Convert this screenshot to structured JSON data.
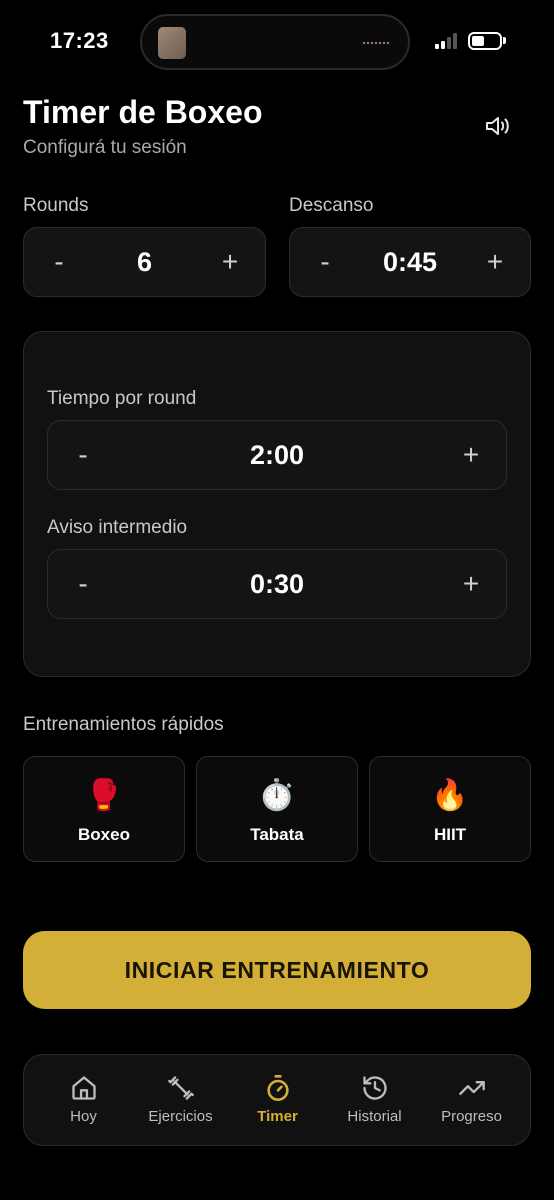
{
  "status_bar": {
    "time": "17:23"
  },
  "header": {
    "title": "Timer de Boxeo",
    "subtitle": "Configurá tu sesión",
    "sound_icon": "speaker-icon"
  },
  "rounds": {
    "label": "Rounds",
    "value": "6",
    "minus": "-",
    "plus": "+"
  },
  "rest": {
    "label": "Descanso",
    "value": "0:45",
    "minus": "-",
    "plus": "+"
  },
  "round_time": {
    "label": "Tiempo por round",
    "value": "2:00",
    "minus": "-",
    "plus": "+"
  },
  "mid_alert": {
    "label": "Aviso intermedio",
    "value": "0:30",
    "minus": "-",
    "plus": "+"
  },
  "quick": {
    "title": "Entrenamientos rápidos",
    "items": [
      {
        "emoji": "🥊",
        "label": "Boxeo",
        "icon": "boxing-glove-icon"
      },
      {
        "emoji": "⏱️",
        "label": "Tabata",
        "icon": "stopwatch-icon"
      },
      {
        "emoji": "🔥",
        "label": "HIIT",
        "icon": "fire-icon"
      }
    ]
  },
  "cta": {
    "label": "INICIAR ENTRENAMIENTO"
  },
  "nav": {
    "items": [
      {
        "label": "Hoy",
        "icon": "home-icon",
        "active": false
      },
      {
        "label": "Ejercicios",
        "icon": "dumbbell-icon",
        "active": false
      },
      {
        "label": "Timer",
        "icon": "timer-icon",
        "active": true
      },
      {
        "label": "Historial",
        "icon": "history-icon",
        "active": false
      },
      {
        "label": "Progreso",
        "icon": "trending-up-icon",
        "active": false
      }
    ]
  },
  "colors": {
    "accent": "#d4af37",
    "background": "#000000",
    "surface": "#141414",
    "border": "#2c2c2c",
    "muted_text": "#a9a9a9",
    "icon_inactive": "#bdbdbd"
  }
}
